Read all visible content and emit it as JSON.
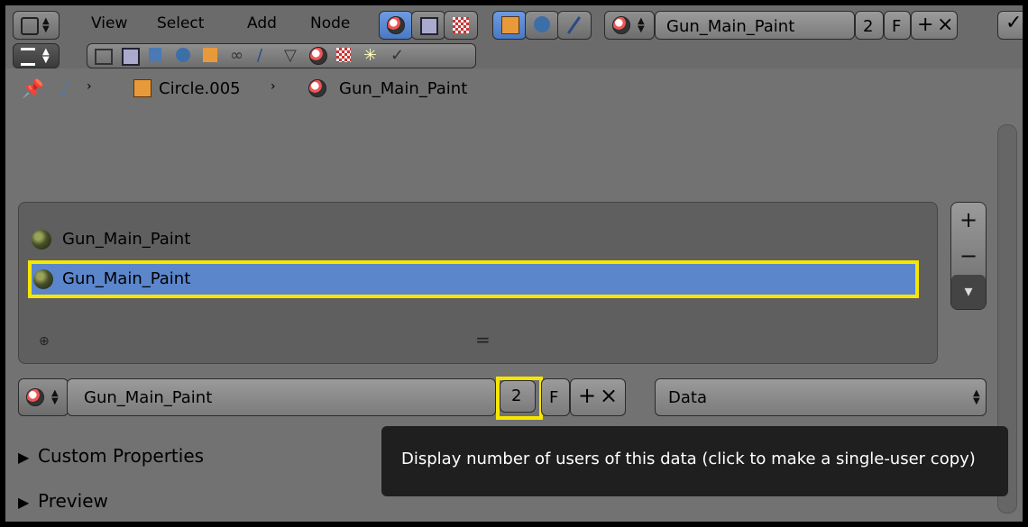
{
  "header": {
    "menus": [
      "View",
      "Select",
      "Add",
      "Node"
    ],
    "material_name": "Gun_Main_Paint",
    "users_count": "2",
    "fake_user_label": "F"
  },
  "breadcrumb": {
    "object_name": "Circle.005",
    "material_name": "Gun_Main_Paint"
  },
  "material_slots": [
    {
      "name": "Gun_Main_Paint"
    },
    {
      "name": "Gun_Main_Paint"
    }
  ],
  "material_datablock": {
    "name": "Gun_Main_Paint",
    "users_count": "2",
    "fake_user_label": "F",
    "link_mode": "Data"
  },
  "tooltip": "Display number of users of this data (click to make a single-user copy)",
  "panels": {
    "custom_properties": "Custom Properties",
    "preview": "Preview"
  },
  "colors": {
    "selection_blue": "#5b86cc",
    "highlight_yellow": "#f6e600",
    "tooltip_bg": "#1f1f1f"
  }
}
